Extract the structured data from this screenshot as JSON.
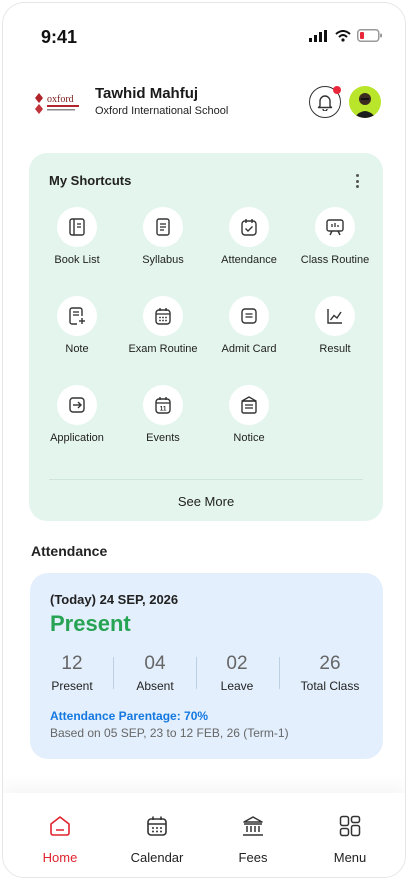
{
  "status_bar": {
    "time": "9:41"
  },
  "header": {
    "user_name": "Tawhid Mahfuj",
    "school_name": "Oxford International School",
    "notification_dot": true
  },
  "shortcuts": {
    "title": "My Shortcuts",
    "items": [
      {
        "label": "Book List",
        "icon": "book-icon"
      },
      {
        "label": "Syllabus",
        "icon": "syllabus-icon"
      },
      {
        "label": "Attendance",
        "icon": "attendance-icon"
      },
      {
        "label": "Class Routine",
        "icon": "class-routine-icon"
      },
      {
        "label": "Note",
        "icon": "note-icon"
      },
      {
        "label": "Exam Routine",
        "icon": "exam-routine-icon"
      },
      {
        "label": "Admit Card",
        "icon": "admit-card-icon"
      },
      {
        "label": "Result",
        "icon": "result-chart-icon"
      },
      {
        "label": "Application",
        "icon": "application-icon"
      },
      {
        "label": "Events",
        "icon": "events-calendar-icon"
      },
      {
        "label": "Notice",
        "icon": "notice-icon"
      }
    ],
    "see_more": "See More"
  },
  "attendance": {
    "heading": "Attendance",
    "date": "(Today) 24 SEP, 2026",
    "status": "Present",
    "status_color": "#27a354",
    "stats": [
      {
        "value": "12",
        "label": "Present"
      },
      {
        "value": "04",
        "label": "Absent"
      },
      {
        "value": "02",
        "label": "Leave"
      },
      {
        "value": "26",
        "label": "Total Class"
      }
    ],
    "percentage": "Attendance Parentage: 70%",
    "based_on": "Based on 05 SEP, 23 to 12 FEB, 26 (Term-1)"
  },
  "bottom_nav": {
    "items": [
      {
        "label": "Home",
        "icon": "home-icon",
        "active": true
      },
      {
        "label": "Calendar",
        "icon": "calendar-icon",
        "active": false
      },
      {
        "label": "Fees",
        "icon": "fees-bank-icon",
        "active": false
      },
      {
        "label": "Menu",
        "icon": "menu-grid-icon",
        "active": false
      }
    ]
  },
  "colors": {
    "accent_red": "#e0242f",
    "shortcuts_bg": "#e4f5ee",
    "attendance_bg": "#e3effc",
    "link_blue": "#1478e0"
  }
}
